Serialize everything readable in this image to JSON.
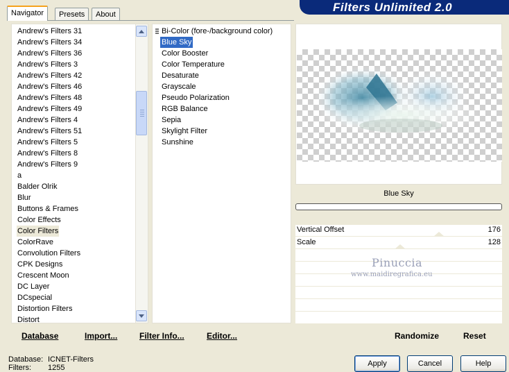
{
  "tabs": [
    "Navigator",
    "Presets",
    "About"
  ],
  "banner": "Filters Unlimited 2.0",
  "categories": {
    "items": [
      "Andrew's Filters 31",
      "Andrew's Filters 34",
      "Andrew's Filters 36",
      "Andrew's Filters 3",
      "Andrew's Filters 42",
      "Andrew's Filters 46",
      "Andrew's Filters 48",
      "Andrew's Filters 49",
      "Andrew's Filters 4",
      "Andrew's Filters 51",
      "Andrew's Filters 5",
      "Andrew's Filters 8",
      "Andrew's Filters 9",
      "a",
      "Balder Olrik",
      "Blur",
      "Buttons & Frames",
      "Color Effects",
      "Color Filters",
      "ColorRave",
      "Convolution Filters",
      "CPK Designs",
      "Crescent Moon",
      "DC Layer",
      "DCspecial",
      "Distortion Filters",
      "Distort"
    ],
    "selected": "Color Filters"
  },
  "filters": {
    "items": [
      "Bi-Color (fore-/background color)",
      "Blue Sky",
      "Color Booster",
      "Color Temperature",
      "Desaturate",
      "Grayscale",
      "Pseudo Polarization",
      "RGB Balance",
      "Sepia",
      "Skylight Filter",
      "Sunshine"
    ],
    "selected": "Blue Sky"
  },
  "filter_name": "Blue Sky",
  "sliders": [
    {
      "label": "Vertical Offset",
      "value": "176"
    },
    {
      "label": "Scale",
      "value": "128"
    }
  ],
  "watermark": {
    "name": "Pinuccia",
    "url": "www.maidiregrafica.eu"
  },
  "buttons": {
    "database": "Database",
    "import": "Import...",
    "filter_info": "Filter Info...",
    "editor": "Editor...",
    "randomize": "Randomize",
    "reset": "Reset",
    "apply": "Apply",
    "cancel": "Cancel",
    "help": "Help"
  },
  "status": {
    "database_label": "Database:",
    "database_value": "ICNET-Filters",
    "filters_label": "Filters:",
    "filters_value": "1255"
  }
}
